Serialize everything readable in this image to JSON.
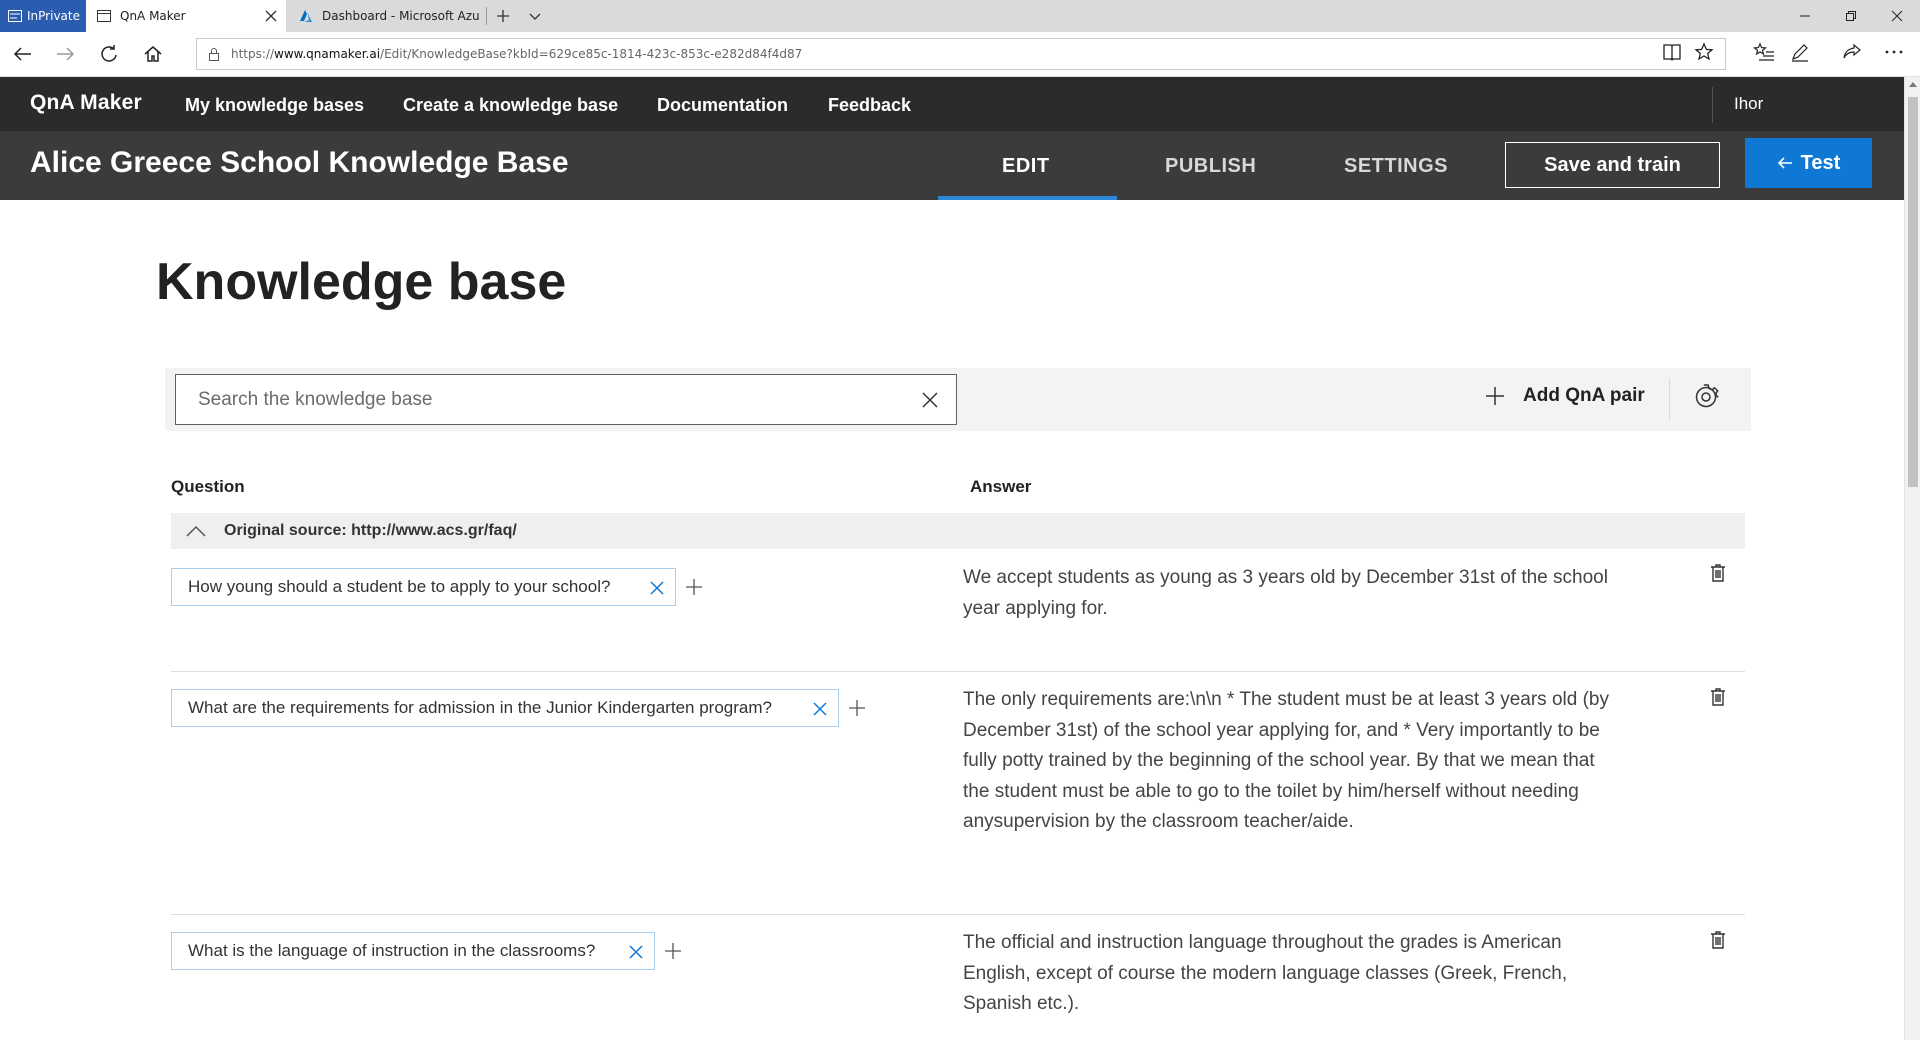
{
  "browser": {
    "inprivate_label": "InPrivate",
    "tabs": [
      {
        "title": "QnA Maker",
        "icon": "page-icon"
      },
      {
        "title": "Dashboard - Microsoft Azu",
        "icon": "azure-icon"
      }
    ],
    "url": {
      "prefix": "https://",
      "host": "www.qnamaker.ai",
      "path": "/Edit/KnowledgeBase?kbId=629ce85c-1814-423c-853c-e282d84f4d87"
    }
  },
  "topnav": {
    "brand": "QnA Maker",
    "links": [
      "My knowledge bases",
      "Create a knowledge base",
      "Documentation",
      "Feedback"
    ],
    "user": "Ihor"
  },
  "kb": {
    "title": "Alice Greece School Knowledge Base",
    "tabs": [
      "EDIT",
      "PUBLISH",
      "SETTINGS"
    ],
    "active_tab": "EDIT",
    "save_label": "Save and train",
    "test_label": "Test",
    "accent": "#0f78d4"
  },
  "page": {
    "title": "Knowledge base",
    "search_placeholder": "Search the knowledge base",
    "add_pair_label": "Add QnA pair",
    "col_question": "Question",
    "col_answer": "Answer",
    "source_label": "Original source: http://www.acs.gr/faq/"
  },
  "qna": [
    {
      "question": "How young should a student be to apply to your school?",
      "answer": "We accept students as young as 3 years old by December 31st of the school year applying for."
    },
    {
      "question": "What are the requirements for admission in the Junior Kindergarten program?",
      "answer": "The only requirements are:\\n\\n * The student must be at least 3 years old (by December 31st) of the school year applying for, and * Very importantly to be fully potty trained by the beginning of the school year. By that we mean that the student must be able to go to the toilet by him/herself without needing anysupervision by the classroom teacher/aide."
    },
    {
      "question": "What is the language of instruction in the classrooms?",
      "answer": "The official and instruction language throughout the grades is American English, except of course the modern language classes (Greek, French, Spanish etc.)."
    }
  ]
}
